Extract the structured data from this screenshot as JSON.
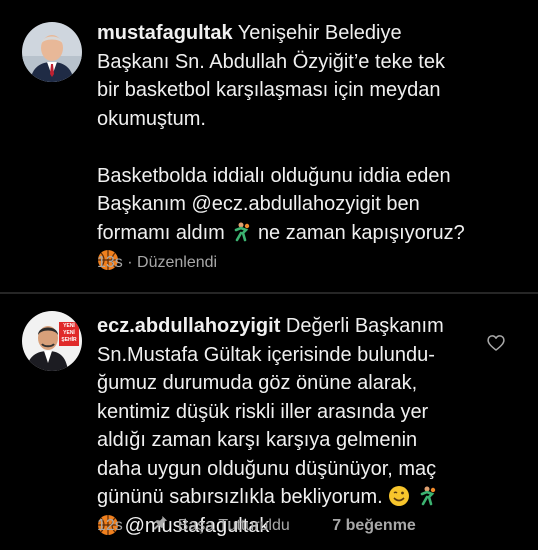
{
  "comments": [
    {
      "username": "mustafagultak",
      "lines": [
        "Yenişehir Belediye",
        "Başkanı Sn. Abdullah Özyiğit’e teke tek",
        "bir basketbol karşılaşması için meydan",
        "okumuştum.",
        "",
        "Basketbolda iddialı olduğunu iddia eden",
        "Başkanım @ecz.abdullahozyigit ben",
        "formamı aldım",
        "ne zaman kapışıyoruz?"
      ],
      "time": "13s",
      "separator": "·",
      "edited": "Düzenlendi"
    },
    {
      "username": "ecz.abdullahozyigit",
      "avatar_badge": [
        "YENİ",
        "YENİ",
        "ŞEHİR"
      ],
      "lines": [
        "Değerli Başkanım",
        "Sn.Mustafa Gültak içerisinde bulundu-",
        "ğumuz durumuda göz önüne alarak,",
        "kentimiz düşük riskli iller arasında yer",
        "aldığı zaman karşı karşıya gelmenin",
        "daha uygun olduğunu düşünüyor, maç",
        "gününü sabırsızlıkla bekliyorum.",
        "@mustafagultak"
      ],
      "time": "12s",
      "pinned_label": "Başa Tutturuldu",
      "likes": "7 beğenme"
    }
  ],
  "icons": {
    "like": "heart-outline-icon",
    "pin": "pin-icon",
    "basketball": "basketball-emoji",
    "player": "basketball-player-emoji",
    "smile": "winking-face-emoji"
  },
  "colors": {
    "background": "#000000",
    "text": "#f5f5f5",
    "meta": "#a8a8a8",
    "divider": "#262626"
  }
}
